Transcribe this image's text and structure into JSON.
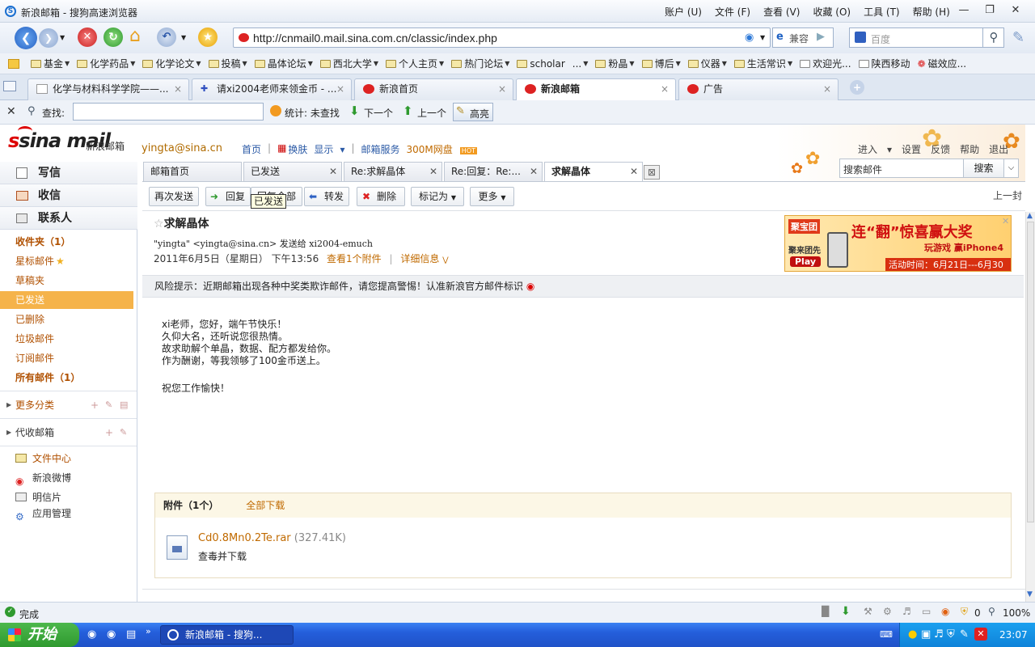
{
  "window": {
    "title": "新浪邮箱 - 搜狗高速浏览器",
    "menus": [
      "账户 (U)",
      "文件 (F)",
      "查看 (V)",
      "收藏 (O)",
      "工具 (T)",
      "帮助 (H)"
    ]
  },
  "navbar": {
    "url": "http://cnmail0.mail.sina.com.cn/classic/index.php",
    "compat_label": "兼容",
    "search_placeholder": "百度"
  },
  "favorites": [
    "基金",
    "化学药品",
    "化学论文",
    "投稿",
    "晶体论坛",
    "西北大学",
    "个人主页",
    "热门论坛",
    "scholar",
    "...",
    "粉晶",
    "博后",
    "仪器",
    "生活常识",
    "欢迎光...",
    "陕西移动",
    "磁效应..."
  ],
  "tabs": [
    {
      "label": "化学与材料科学学院——...",
      "active": false
    },
    {
      "label": "请xi2004老师来领金币 - ...",
      "active": false
    },
    {
      "label": "新浪首页",
      "active": false
    },
    {
      "label": "新浪邮箱",
      "active": true
    },
    {
      "label": "广告",
      "active": false
    }
  ],
  "findbar": {
    "find_label": "查找:",
    "stats_label": "统计: 未查找",
    "next_label": "下一个",
    "prev_label": "上一个",
    "highlight_label": "高亮"
  },
  "mail": {
    "brand": "sina mail",
    "brand_sub": "新浪邮箱",
    "user_email": "yingta@sina.cn",
    "top_nav": [
      "首页",
      "换肤",
      "显示",
      "邮箱服务",
      "300M网盘"
    ],
    "hot_badge": "HOT",
    "right_nav": [
      "进入",
      "设置",
      "反馈",
      "帮助",
      "退出"
    ],
    "search_placeholder": "搜索邮件",
    "search_button": "搜索"
  },
  "sidebar": {
    "compose": "写信",
    "receive": "收信",
    "contacts": "联系人",
    "folders": [
      {
        "label": "收件夹（1）",
        "bold": true
      },
      {
        "label": "星标邮件",
        "bold": false
      },
      {
        "label": "草稿夹",
        "bold": false
      },
      {
        "label": "已发送",
        "bold": false,
        "active": true
      },
      {
        "label": "已删除",
        "bold": false
      },
      {
        "label": "垃圾邮件",
        "bold": false
      },
      {
        "label": "订阅邮件",
        "bold": false
      },
      {
        "label": "所有邮件（1）",
        "bold": true
      }
    ],
    "more_categories": "更多分类",
    "proxy_mail": "代收邮箱",
    "apps": [
      "文件中心",
      "新浪微博",
      "明信片",
      "应用管理"
    ]
  },
  "mail_tabs": [
    {
      "label": "邮箱首页",
      "closable": false
    },
    {
      "label": "已发送",
      "closable": true
    },
    {
      "label": "Re:求解晶体",
      "closable": true
    },
    {
      "label": "Re:回复：Re:...",
      "closable": true
    },
    {
      "label": "求解晶体",
      "closable": true,
      "active": true
    }
  ],
  "toolbar": {
    "resend": "再次发送",
    "reply": "回复",
    "reply_all": "回复全部",
    "tooltip": "已发送",
    "forward": "转发",
    "delete": "删除",
    "mark_as": "标记为",
    "more": "更多",
    "prev_mail": "上一封"
  },
  "message": {
    "subject": "求解晶体",
    "from_line": "\"yingta\" <yingta@sina.cn> 发送给 xi2004-emuch",
    "date": "2011年6月5日（星期日） 下午13:56",
    "view_attachment": "查看1个附件",
    "details": "详细信息",
    "risk_notice": "风险提示：近期邮箱出现各种中奖类欺诈邮件，请您提高警惕！认准新浪官方邮件标识",
    "body_lines": [
      "xi老师，您好，端午节快乐！",
      "久仰大名，还听说您很热情。",
      "故求助解个单晶，数据、配方都发给你。",
      "作为酬谢，等我领够了100金币送上。",
      "",
      "祝您工作愉快！"
    ]
  },
  "ad": {
    "site": "聚宝团",
    "headline": "连“翻”惊喜赢大奖",
    "sub1": "玩游戏 赢iPhone4",
    "sub2": "活动时间：6月21日---6月30日",
    "play": "Play",
    "side": "聚来团先"
  },
  "attachments": {
    "header": "附件（1个）",
    "download_all": "全部下载",
    "files": [
      {
        "name": "Cd0.8Mn0.2Te.rar",
        "size": "(327.41K)",
        "action": "查毒并下载"
      }
    ]
  },
  "statusbar": {
    "status": "完成",
    "count": "0",
    "zoom": "100%"
  },
  "taskbar": {
    "start": "开始",
    "item": "新浪邮箱 - 搜狗...",
    "clock": "23:07"
  },
  "colors": {
    "accent_orange": "#f5b34a",
    "sina_red": "#d00000",
    "link_blue": "#2b5aa6"
  }
}
